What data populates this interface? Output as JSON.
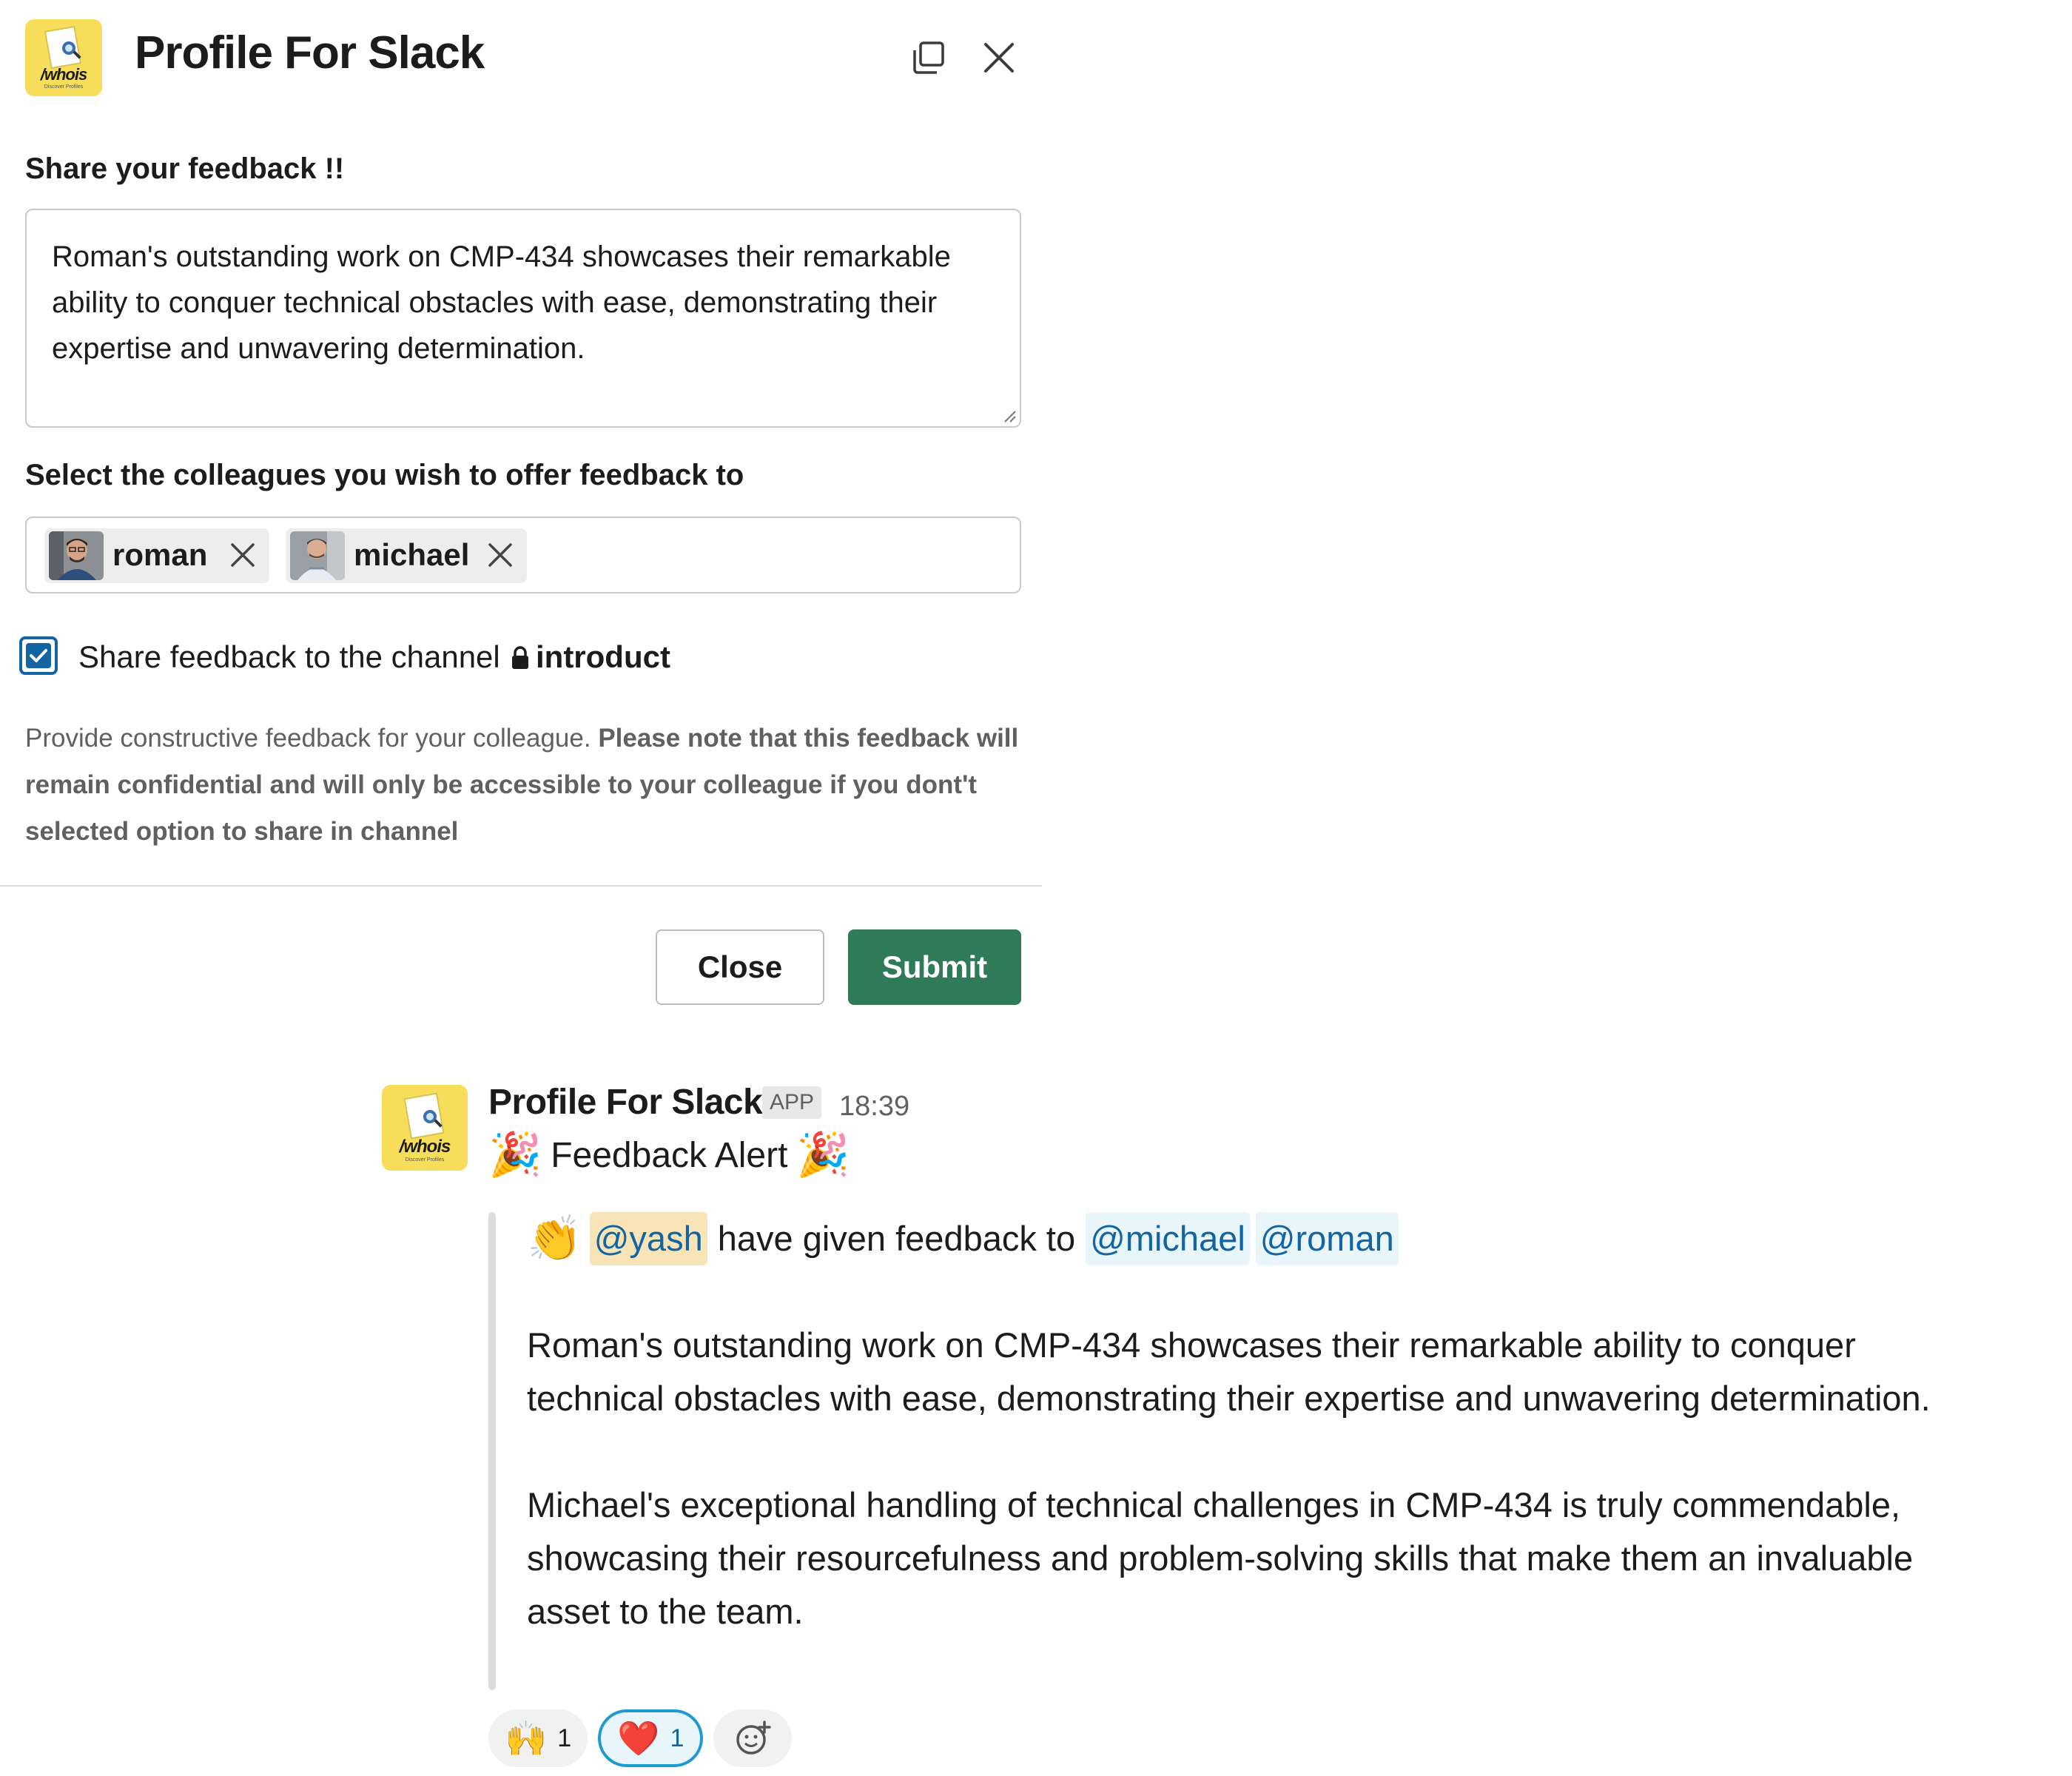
{
  "modal": {
    "title": "Profile For Slack",
    "logo_text": "/whois",
    "logo_subtext": "Discover Profiles",
    "feedback_label": "Share your feedback !!",
    "feedback_value": "Roman's outstanding work on CMP-434 showcases their remarkable ability to conquer technical obstacles with ease, demonstrating their expertise and unwavering determination.",
    "colleagues_label": "Select the colleagues you wish to offer feedback to",
    "selected_colleagues": [
      {
        "name": "roman"
      },
      {
        "name": "michael"
      }
    ],
    "share_checkbox": {
      "label": "Share feedback to the channel",
      "checked": true,
      "channel": "introduct"
    },
    "help_text_plain": "Provide constructive feedback for your colleague. ",
    "help_text_bold": "Please note that this feedback will remain confidential and will only be accessible to your colleague if you dont't selected option to share in channel",
    "close_label": "Close",
    "submit_label": "Submit"
  },
  "message": {
    "sender": "Profile For Slack",
    "badge": "APP",
    "time": "18:39",
    "alert_title": "Feedback Alert",
    "author_mention": "@yash",
    "given_text": "have given feedback to",
    "recipients": [
      "@michael",
      "@roman"
    ],
    "paragraph_1": "Roman's outstanding work on CMP-434 showcases their remarkable ability to conquer technical obstacles with ease, demonstrating their expertise and unwavering determination.",
    "paragraph_2": "Michael's exceptional handling of technical challenges in CMP-434 is truly commendable, showcasing their resourcefulness and problem-solving skills that make them an invaluable asset to the team.",
    "reactions": [
      {
        "emoji": "🙌",
        "count": "1",
        "active": false
      },
      {
        "emoji": "❤️",
        "count": "1",
        "active": true
      }
    ]
  },
  "colors": {
    "submit_green": "#2f7a57",
    "link_blue": "#1264a3",
    "logo_yellow": "#f6dd5a",
    "self_mention_bg": "#f9e4b7",
    "mention_bg": "#e8f5fa"
  },
  "icons": [
    "popout-window-icon",
    "close-icon",
    "remove-chip-icon",
    "checkmark-icon",
    "lock-icon",
    "party-popper-icon",
    "clapping-hands-icon",
    "add-reaction-icon"
  ]
}
